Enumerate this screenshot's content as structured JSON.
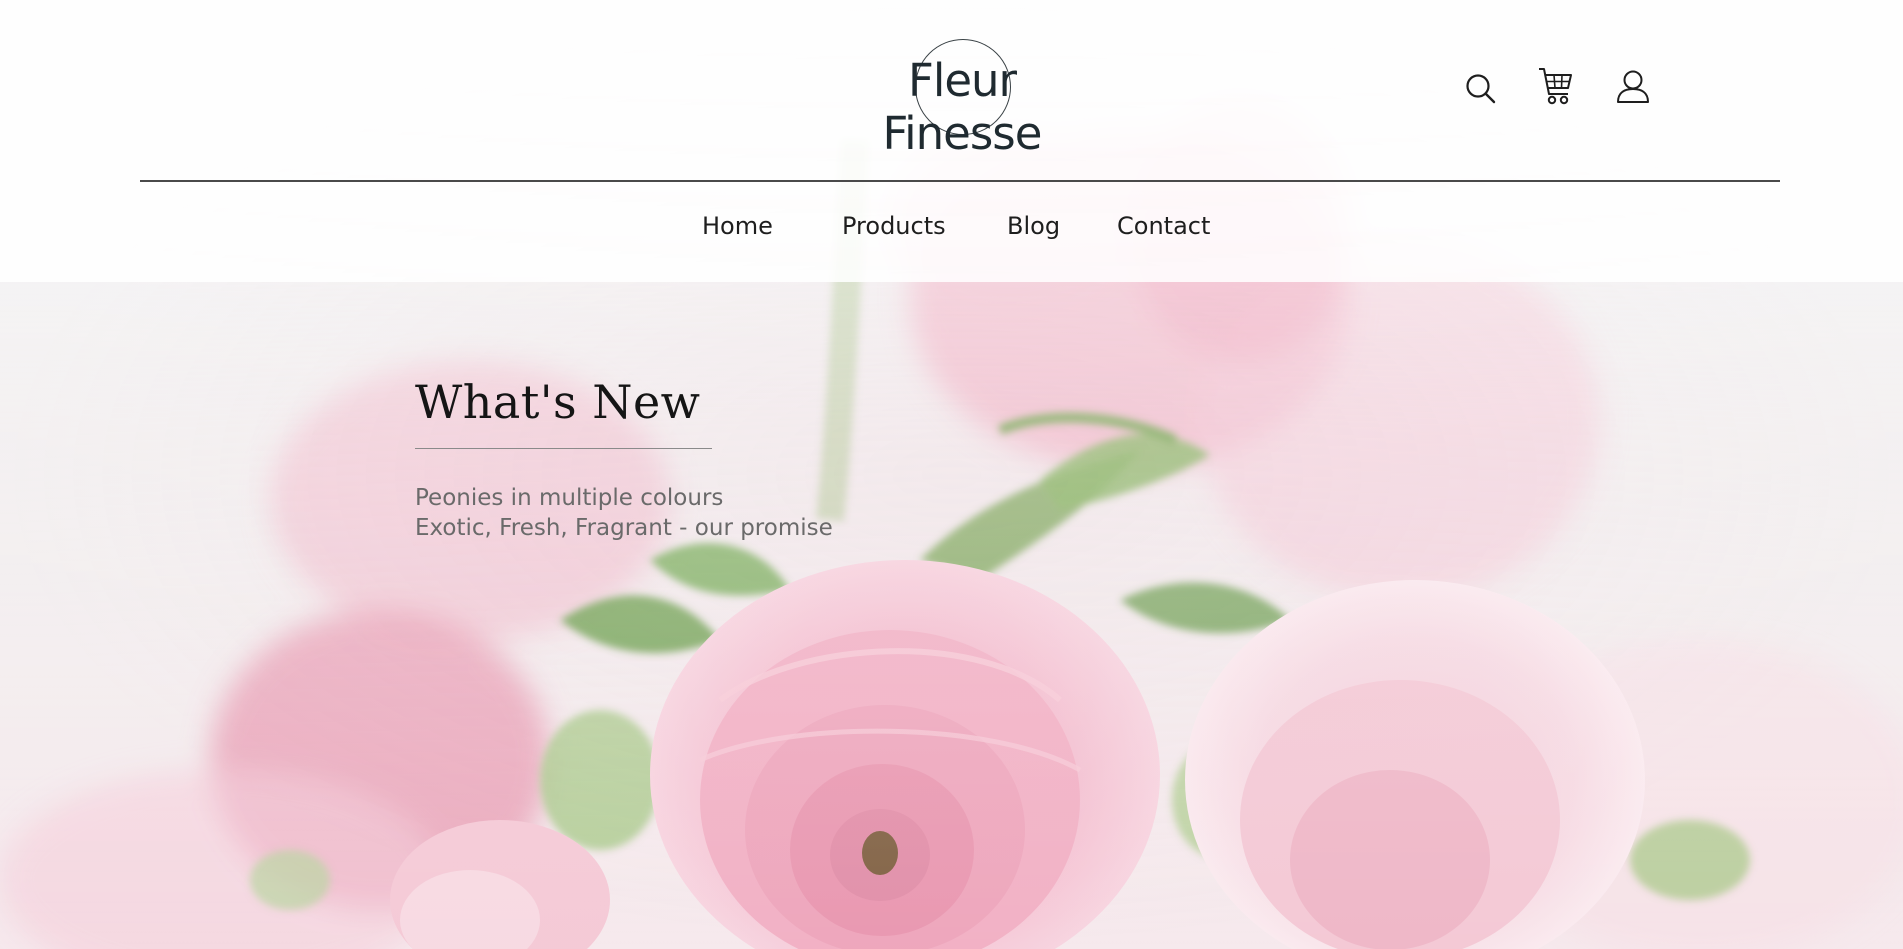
{
  "brand": {
    "logo_text": "Fleur Finesse",
    "accent_color": "#f4b8cc"
  },
  "header_icons": [
    {
      "name": "search-icon",
      "label": "Search"
    },
    {
      "name": "cart-icon",
      "label": "Cart"
    },
    {
      "name": "user-icon",
      "label": "Account"
    }
  ],
  "nav": {
    "items": [
      {
        "label": "Home"
      },
      {
        "label": "Products"
      },
      {
        "label": "Blog"
      },
      {
        "label": "Contact"
      }
    ]
  },
  "promo": {
    "title": "What's New",
    "lines": [
      "Peonies in multiple colours",
      "Exotic, Fresh, Fragrant - our promise"
    ]
  },
  "colors": {
    "text_dark": "#151515",
    "text_muted": "#6a6a6a",
    "petal_pink": "#f2b3c7",
    "leaf_green": "#7fae5a"
  }
}
